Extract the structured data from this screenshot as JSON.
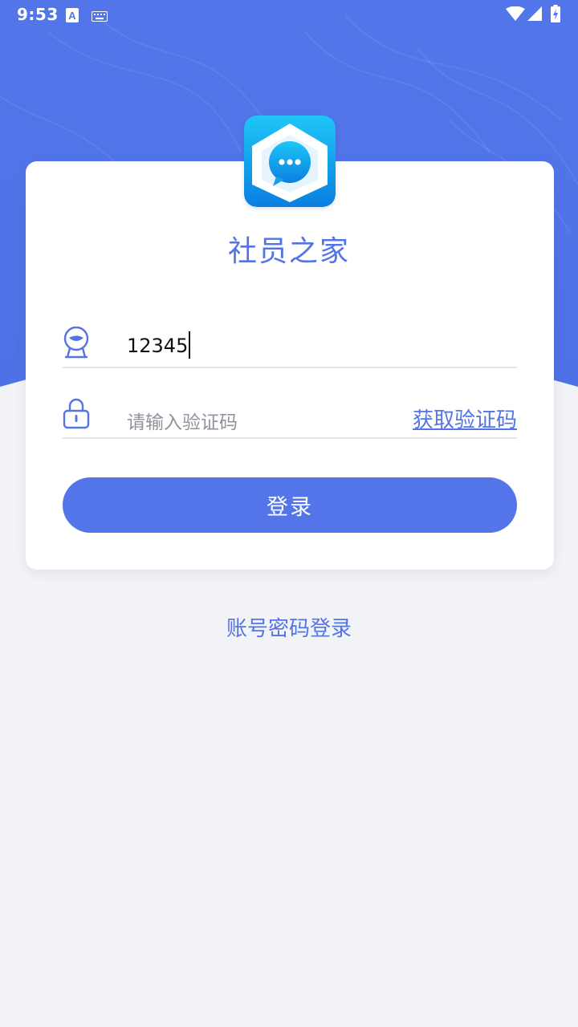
{
  "status_bar": {
    "time": "9:53",
    "icons": [
      "text-icon",
      "keyboard-icon",
      "wifi-icon",
      "signal-icon",
      "battery-charging-icon"
    ]
  },
  "app": {
    "title": "社员之家",
    "logo_icon": "house-chat-icon"
  },
  "form": {
    "username": {
      "icon": "user-avatar-icon",
      "value": "12345"
    },
    "code": {
      "icon": "lock-icon",
      "placeholder": "请输入验证码",
      "get_code_label": "获取验证码"
    },
    "login_label": "登录"
  },
  "alt_login_label": "账号密码登录",
  "colors": {
    "primary": "#5474e9",
    "header_blue": "#5278ea",
    "background": "#f2f3f6",
    "card": "#ffffff",
    "placeholder": "#8f939c"
  }
}
